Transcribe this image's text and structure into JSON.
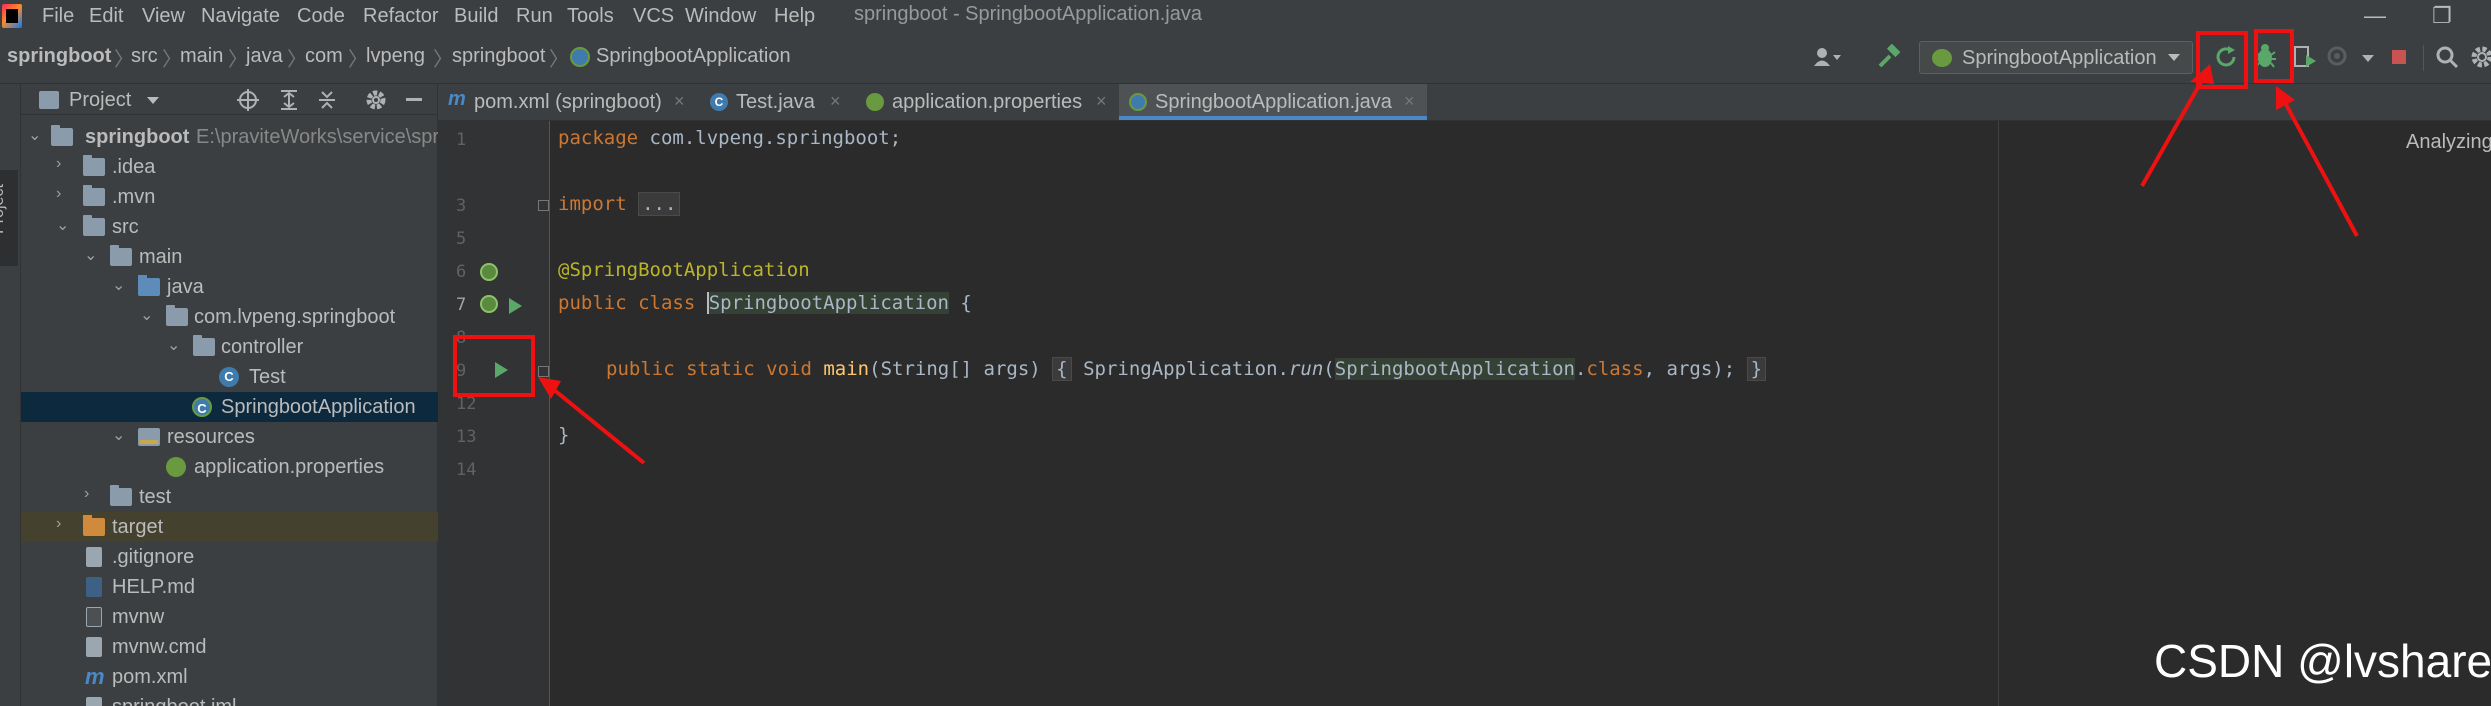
{
  "menu": {
    "items": [
      "File",
      "Edit",
      "View",
      "Navigate",
      "Code",
      "Refactor",
      "Build",
      "Run",
      "Tools",
      "VCS",
      "Window",
      "Help"
    ],
    "window_title": "springboot - SpringbootApplication.java",
    "minimize": "—",
    "restore": "❐"
  },
  "breadcrumb": [
    "springboot",
    "src",
    "main",
    "java",
    "com",
    "lvpeng",
    "springboot",
    "SpringbootApplication"
  ],
  "toolbar": {
    "run_config": "SpringbootApplication"
  },
  "project_panel": {
    "title": "Project",
    "tree": [
      {
        "label": "springboot",
        "path": "E:\\praviteWorks\\service\\spri",
        "bold": true
      },
      {
        "label": ".idea"
      },
      {
        "label": ".mvn"
      },
      {
        "label": "src"
      },
      {
        "label": "main"
      },
      {
        "label": "java"
      },
      {
        "label": "com.lvpeng.springboot"
      },
      {
        "label": "controller"
      },
      {
        "label": "Test"
      },
      {
        "label": "SpringbootApplication"
      },
      {
        "label": "resources"
      },
      {
        "label": "application.properties"
      },
      {
        "label": "test"
      },
      {
        "label": "target"
      },
      {
        "label": ".gitignore"
      },
      {
        "label": "HELP.md"
      },
      {
        "label": "mvnw"
      },
      {
        "label": "mvnw.cmd"
      },
      {
        "label": "pom.xml"
      },
      {
        "label": "springboot.iml"
      }
    ]
  },
  "editor": {
    "tabs": [
      {
        "label": "pom.xml (springboot)"
      },
      {
        "label": "Test.java"
      },
      {
        "label": "application.properties"
      },
      {
        "label": "SpringbootApplication.java"
      }
    ],
    "line_numbers": [
      "1",
      "3",
      "5",
      "6",
      "7",
      "8",
      "9",
      "12",
      "13",
      "14"
    ],
    "code": {
      "l1_kw": "package",
      "l1_rest": " com.lvpeng.springboot;",
      "l3_kw": "import",
      "l3_fold": "...",
      "l6": "@SpringBootApplication",
      "l7_kw": "public class",
      "l7_class": "SpringbootApplication",
      "l7_rest": " {",
      "l9_kw": "public static void",
      "l9_fn": "main",
      "l9_args": "(String[] args)",
      "l9_open": "{",
      "l9_call": " SpringApplication.",
      "l9_run": "run",
      "l9_paren": "(",
      "l9_cls": "SpringbootApplication",
      "l9_dot": ".",
      "l9_classkw": "class",
      "l9_end": ", args);",
      "l9_close": "}",
      "l13": "}"
    },
    "status": "Analyzing"
  },
  "watermark": "CSDN @lvshare",
  "colors": {
    "annotation_red": "#ee1111",
    "run_green": "#59a869",
    "accent_blue": "#4a88c7"
  }
}
